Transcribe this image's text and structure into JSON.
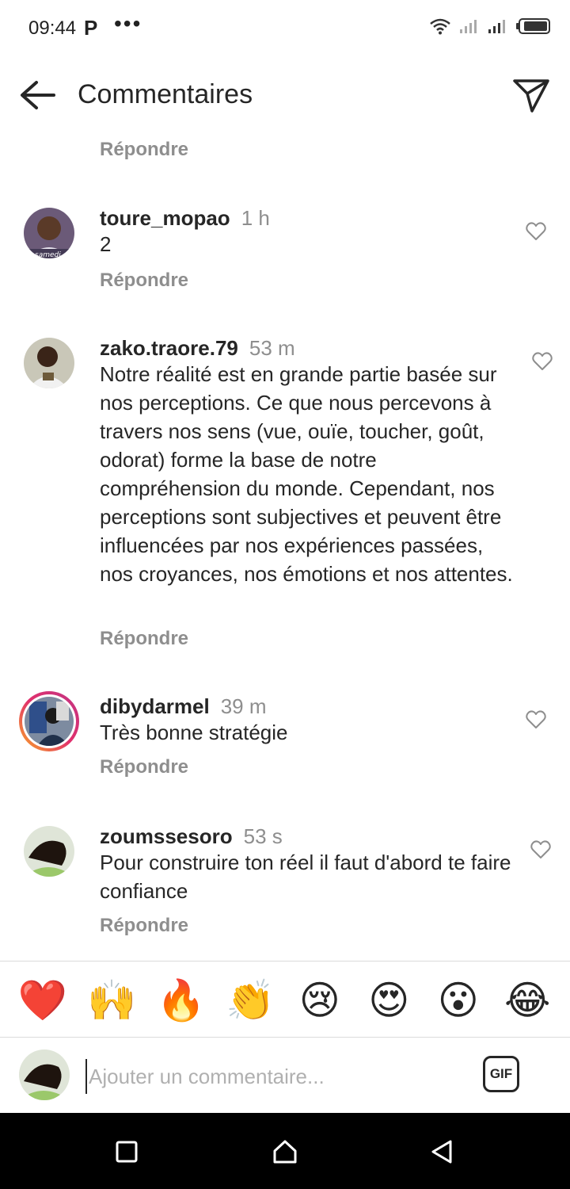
{
  "status_bar": {
    "time": "09:44",
    "app_indicator": "P",
    "more": "•••",
    "icons": [
      "wifi-icon",
      "signal-icon",
      "signal-icon",
      "battery-icon"
    ]
  },
  "header": {
    "title": "Commentaires",
    "back_icon": "arrow-left-icon",
    "share_icon": "paper-plane-icon"
  },
  "top_reply_label": "Répondre",
  "comments": [
    {
      "username": "toure_mopao",
      "time": "1 h",
      "text": "2",
      "reply_label": "Répondre",
      "avatar_caption": "samedi"
    },
    {
      "username": "zako.traore.79",
      "time": "53 m",
      "text": "Notre réalité est en grande partie basée sur nos perceptions. Ce que nous percevons à travers nos sens (vue, ouïe, toucher, goût, odorat) forme la base de notre compréhension du monde. Cependant, nos perceptions sont subjectives et peuvent être influencées par nos expériences passées, nos croyances, nos émotions et nos attentes.",
      "reply_label": "Répondre"
    },
    {
      "username": "dibydarmel",
      "time": "39 m",
      "text": "Très bonne stratégie",
      "reply_label": "Répondre",
      "has_story_ring": true
    },
    {
      "username": "zoumssesoro",
      "time": "53 s",
      "text": "Pour construire ton réel il faut d'abord te faire confiance",
      "reply_label": "Répondre"
    }
  ],
  "emoji_bar": [
    "❤️",
    "🙌",
    "🔥",
    "👏",
    "😢",
    "😍",
    "😮",
    "😂"
  ],
  "comment_input": {
    "placeholder": "Ajouter un commentaire...",
    "value": ""
  },
  "gif_label": "GIF",
  "nav_bar": {
    "buttons": [
      "square-icon",
      "home-icon",
      "back-triangle-icon"
    ]
  },
  "colors": {
    "text": "#262626",
    "secondary": "#8e8e8e",
    "heart_red": "#ed4956",
    "story_ring_start": "#f9a825",
    "story_ring_end": "#c13584"
  }
}
